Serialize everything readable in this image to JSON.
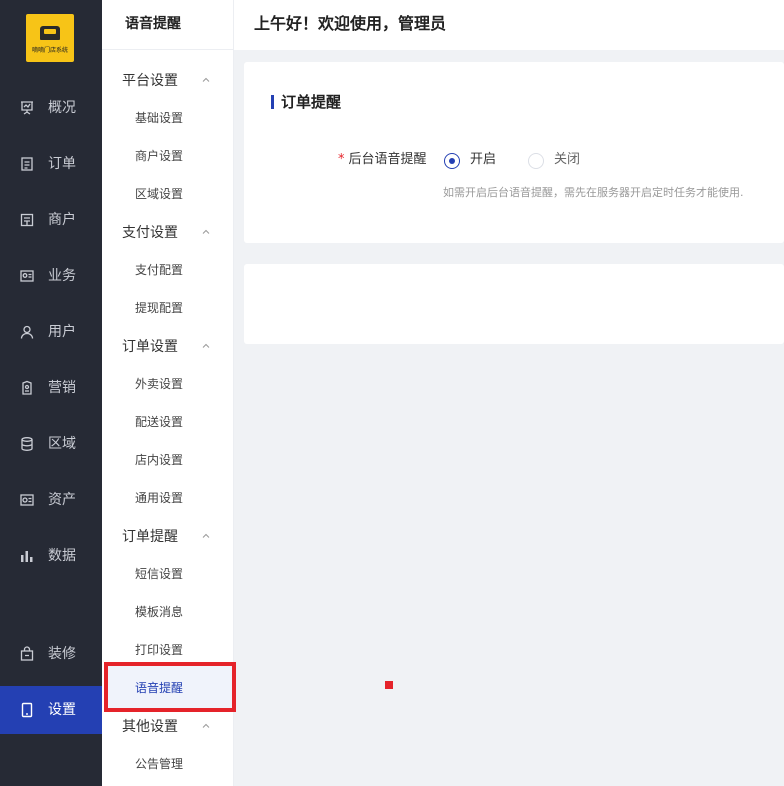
{
  "logo": {
    "text": "嘀嘀门店系统"
  },
  "nav": {
    "items": [
      {
        "label": "概况",
        "icon": "presentation-icon"
      },
      {
        "label": "订单",
        "icon": "document-icon"
      },
      {
        "label": "商户",
        "icon": "store-icon"
      },
      {
        "label": "业务",
        "icon": "id-card-icon"
      },
      {
        "label": "用户",
        "icon": "user-icon"
      },
      {
        "label": "营销",
        "icon": "tag-icon"
      },
      {
        "label": "区域",
        "icon": "database-icon"
      },
      {
        "label": "资产",
        "icon": "wallet-icon"
      },
      {
        "label": "数据",
        "icon": "bar-chart-icon"
      },
      {
        "label": "装修",
        "icon": "shopping-bag-icon"
      },
      {
        "label": "设置",
        "icon": "tablet-icon"
      }
    ],
    "active": "设置"
  },
  "submenu": {
    "title": "语音提醒",
    "groups": [
      {
        "label": "平台设置",
        "items": [
          "基础设置",
          "商户设置",
          "区域设置"
        ]
      },
      {
        "label": "支付设置",
        "items": [
          "支付配置",
          "提现配置"
        ]
      },
      {
        "label": "订单设置",
        "items": [
          "外卖设置",
          "配送设置",
          "店内设置",
          "通用设置"
        ]
      },
      {
        "label": "订单提醒",
        "items": [
          "短信设置",
          "模板消息",
          "打印设置",
          "语音提醒"
        ]
      },
      {
        "label": "其他设置",
        "items": [
          "公告管理"
        ]
      }
    ],
    "active_item": "语音提醒"
  },
  "header": {
    "greeting": "上午好！欢迎使用，管理员"
  },
  "card": {
    "title": "订单提醒",
    "field": {
      "required_mark": "*",
      "label": "后台语音提醒",
      "options": [
        "开启",
        "关闭"
      ],
      "selected": "开启",
      "hint": "如需开启后台语音提醒，需先在服务器开启定时任务才能使用."
    }
  },
  "colors": {
    "accent": "#2440b3",
    "nav_bg": "#262a35",
    "logo_bg": "#f7c417",
    "highlight": "#e5232a"
  }
}
